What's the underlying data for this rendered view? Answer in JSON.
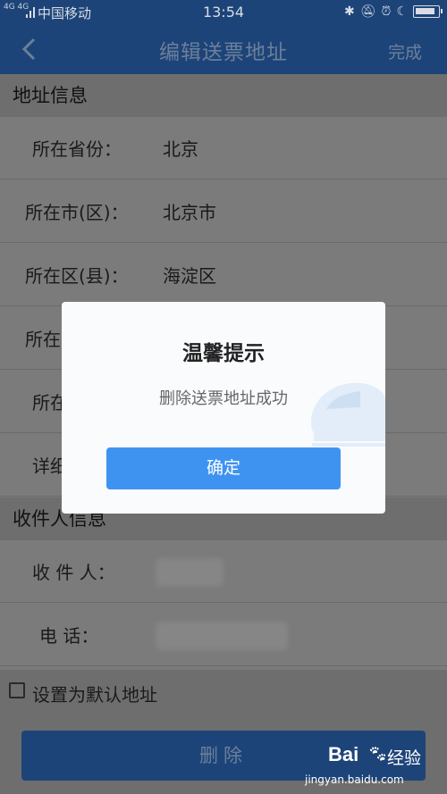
{
  "status_bar": {
    "network": "4G 4G",
    "carrier": "中国移动",
    "time": "13:54"
  },
  "nav": {
    "title": "编辑送票地址",
    "done_label": "完成"
  },
  "address_section": {
    "header": "地址信息",
    "rows": [
      {
        "label": "所在省份：",
        "value": "北京"
      },
      {
        "label": "所在市(区)：",
        "value": "北京市"
      },
      {
        "label": "所在区(县)：",
        "value": "海淀区"
      },
      {
        "label": "所在",
        "value": ""
      },
      {
        "label": "所在",
        "value": ""
      },
      {
        "label": "详细",
        "value": ""
      }
    ]
  },
  "recipient_section": {
    "header": "收件人信息",
    "rows": [
      {
        "label": "收 件 人：",
        "value": ""
      },
      {
        "label": "电    话：",
        "value": ""
      }
    ]
  },
  "default_checkbox": {
    "label": "设置为默认地址",
    "checked": false
  },
  "delete_button": "删除",
  "dialog": {
    "title": "温馨提示",
    "message": "删除送票地址成功",
    "ok_label": "确定"
  },
  "watermark": {
    "brand": "Bai",
    "name": "经验",
    "url": "jingyan.baidu.com"
  },
  "colors": {
    "nav_bg": "#1d4478",
    "overlay": "#7b7b7b",
    "dialog_button": "#3f93f0"
  }
}
